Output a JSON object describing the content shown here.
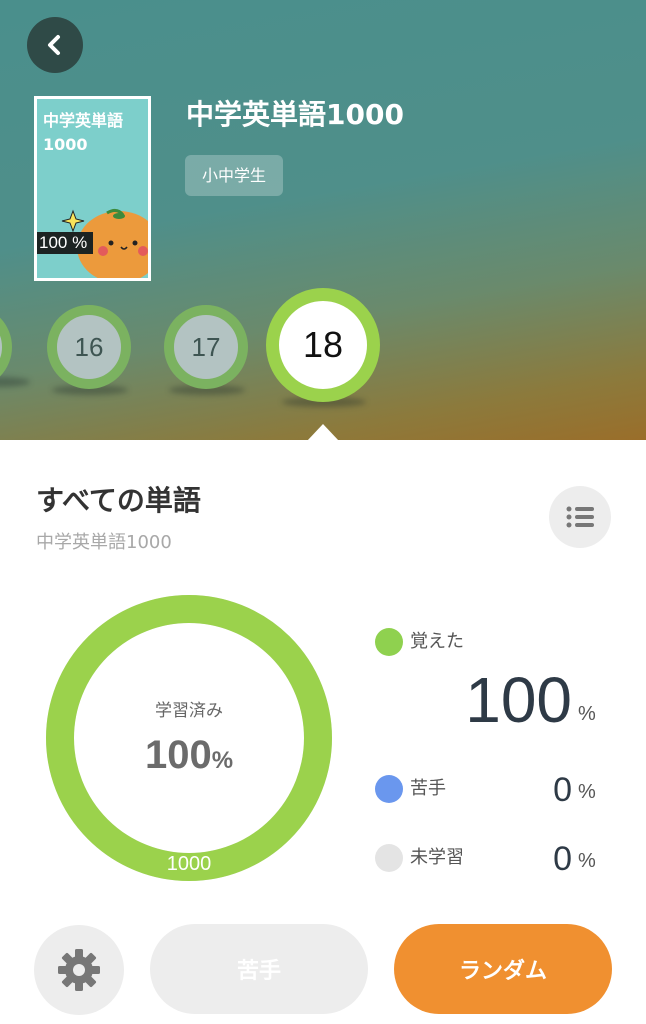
{
  "header": {
    "back_icon": "chevron-left-icon",
    "book": {
      "cover_title": "中学英単語\n1000",
      "cover_progress": "100 %",
      "title": "中学英単語1000",
      "tag": "小中学生"
    },
    "chapters": [
      {
        "label": "",
        "state": "partial"
      },
      {
        "label": "16",
        "state": "normal"
      },
      {
        "label": "17",
        "state": "normal"
      },
      {
        "label": "18",
        "state": "selected"
      }
    ]
  },
  "section": {
    "title": "すべての単語",
    "subtitle": "中学英単語1000",
    "list_icon": "list-icon"
  },
  "progress": {
    "center_label": "学習済み",
    "center_value": "100",
    "center_unit": "%",
    "total": "1000",
    "learned_fraction": 1.0
  },
  "legend": [
    {
      "label": "覚えた",
      "value": "100",
      "unit": "%",
      "color": "#8fd14f"
    },
    {
      "label": "苦手",
      "value": "0",
      "unit": "%",
      "color": "#6a97ee"
    },
    {
      "label": "未学習",
      "value": "0",
      "unit": "%",
      "color": "#e4e4e4"
    }
  ],
  "actions": {
    "settings_icon": "gear-icon",
    "weak_label": "苦手",
    "random_label": "ランダム"
  },
  "colors": {
    "accent_green": "#9bd24c",
    "button_orange": "#f09030",
    "header_teal": "#4f8f8a"
  }
}
